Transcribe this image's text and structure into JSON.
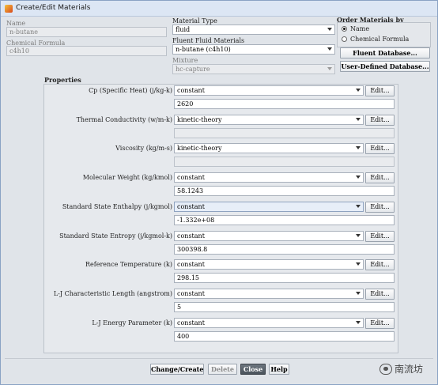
{
  "window": {
    "title": "Create/Edit Materials"
  },
  "name": {
    "label": "Name",
    "value": "n-butane"
  },
  "chemical_formula": {
    "label": "Chemical Formula",
    "value": "c4h10"
  },
  "material_type": {
    "label": "Material Type",
    "value": "fluid"
  },
  "fluent_fluid_materials": {
    "label": "Fluent Fluid Materials",
    "value": "n-butane (c4h10)"
  },
  "mixture": {
    "label": "Mixture",
    "value": "hc-capture"
  },
  "order": {
    "label": "Order Materials by",
    "options": [
      {
        "label": "Name",
        "selected": true
      },
      {
        "label": "Chemical Formula",
        "selected": false
      }
    ]
  },
  "database_buttons": {
    "fluent_database": "Fluent Database...",
    "user_defined_database": "User-Defined Database..."
  },
  "properties": {
    "label": "Properties",
    "edit_label": "Edit...",
    "rows": [
      {
        "label": "Cp (Specific Heat) (j/kg-k)",
        "method": "constant",
        "value": "2620"
      },
      {
        "label": "Thermal Conductivity (w/m-k)",
        "method": "kinetic-theory",
        "value": ""
      },
      {
        "label": "Viscosity (kg/m-s)",
        "method": "kinetic-theory",
        "value": ""
      },
      {
        "label": "Molecular Weight (kg/kmol)",
        "method": "constant",
        "value": "58.1243"
      },
      {
        "label": "Standard State Enthalpy (j/kgmol)",
        "method": "constant",
        "value": "-1.332e+08"
      },
      {
        "label": "Standard State Entropy (j/kgmol-k)",
        "method": "constant",
        "value": "300398.8"
      },
      {
        "label": "Reference Temperature (k)",
        "method": "constant",
        "value": "298.15"
      },
      {
        "label": "L-J Characteristic Length (angstrom)",
        "method": "constant",
        "value": "5"
      },
      {
        "label": "L-J Energy Parameter (k)",
        "method": "constant",
        "value": "400"
      }
    ]
  },
  "footer": {
    "change_create": "Change/Create",
    "delete": "Delete",
    "close": "Close",
    "help": "Help"
  },
  "watermark": {
    "text": "南流坊",
    "icon": "wechat-icon"
  }
}
